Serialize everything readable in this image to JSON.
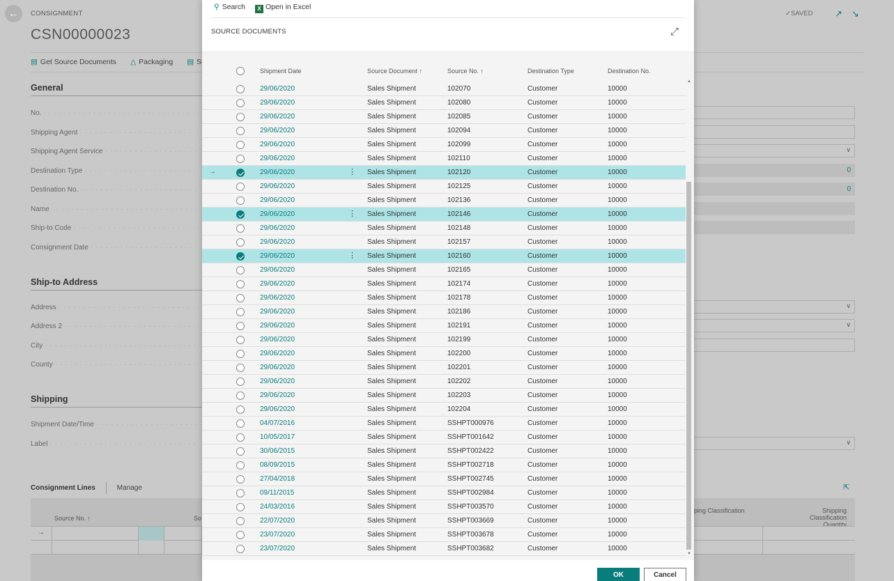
{
  "background": {
    "caption": "CONSIGNMENT",
    "doc_no": "CSN00000023",
    "saved": "SAVED",
    "actions": [
      "Get Source Documents",
      "Packaging",
      "Su"
    ],
    "general": {
      "title": "General",
      "fields": [
        "No.",
        "Shipping Agent",
        "Shipping Agent Service",
        "Destination Type",
        "Destination No.",
        "Name",
        "Ship-to Code",
        "Consignment Date"
      ],
      "right_values": {
        "destination_type": "0",
        "destination_no": "0"
      }
    },
    "ship_to": {
      "title": "Ship-to Address",
      "fields": [
        "Address",
        "Address 2",
        "City",
        "County"
      ]
    },
    "shipping": {
      "title": "Shipping",
      "fields": [
        "Shipment Date/Time",
        "Label"
      ]
    },
    "lines": {
      "tab": "Consignment Lines",
      "manage": "Manage",
      "col_source_no": "Source No. ↑",
      "col_so": "So",
      "col_ship_class": "ping Classification",
      "col_ship_class_qty_1": "Shipping Classification",
      "col_ship_class_qty_2": "Quantity"
    }
  },
  "modal": {
    "toolbar": {
      "search": "Search",
      "excel": "Open in Excel"
    },
    "title": "SOURCE DOCUMENTS",
    "columns": {
      "shipment_date": "Shipment Date",
      "source_document": "Source Document ↑",
      "source_no": "Source No. ↑",
      "destination_type": "Destination Type",
      "destination_no": "Destination No."
    },
    "rows": [
      {
        "date": "29/06/2020",
        "doc": "Sales Shipment",
        "no": "102070",
        "dtype": "Customer",
        "dno": "10000",
        "sel": false
      },
      {
        "date": "29/06/2020",
        "doc": "Sales Shipment",
        "no": "102080",
        "dtype": "Customer",
        "dno": "10000",
        "sel": false
      },
      {
        "date": "29/06/2020",
        "doc": "Sales Shipment",
        "no": "102085",
        "dtype": "Customer",
        "dno": "10000",
        "sel": false
      },
      {
        "date": "29/06/2020",
        "doc": "Sales Shipment",
        "no": "102094",
        "dtype": "Customer",
        "dno": "10000",
        "sel": false
      },
      {
        "date": "29/06/2020",
        "doc": "Sales Shipment",
        "no": "102099",
        "dtype": "Customer",
        "dno": "10000",
        "sel": false
      },
      {
        "date": "29/06/2020",
        "doc": "Sales Shipment",
        "no": "102110",
        "dtype": "Customer",
        "dno": "10000",
        "sel": false
      },
      {
        "date": "29/06/2020",
        "doc": "Sales Shipment",
        "no": "102120",
        "dtype": "Customer",
        "dno": "10000",
        "sel": true,
        "current": true
      },
      {
        "date": "29/06/2020",
        "doc": "Sales Shipment",
        "no": "102125",
        "dtype": "Customer",
        "dno": "10000",
        "sel": false
      },
      {
        "date": "29/06/2020",
        "doc": "Sales Shipment",
        "no": "102136",
        "dtype": "Customer",
        "dno": "10000",
        "sel": false
      },
      {
        "date": "29/06/2020",
        "doc": "Sales Shipment",
        "no": "102146",
        "dtype": "Customer",
        "dno": "10000",
        "sel": true
      },
      {
        "date": "29/06/2020",
        "doc": "Sales Shipment",
        "no": "102148",
        "dtype": "Customer",
        "dno": "10000",
        "sel": false
      },
      {
        "date": "29/06/2020",
        "doc": "Sales Shipment",
        "no": "102157",
        "dtype": "Customer",
        "dno": "10000",
        "sel": false
      },
      {
        "date": "29/06/2020",
        "doc": "Sales Shipment",
        "no": "102160",
        "dtype": "Customer",
        "dno": "10000",
        "sel": true
      },
      {
        "date": "29/06/2020",
        "doc": "Sales Shipment",
        "no": "102165",
        "dtype": "Customer",
        "dno": "10000",
        "sel": false
      },
      {
        "date": "29/06/2020",
        "doc": "Sales Shipment",
        "no": "102174",
        "dtype": "Customer",
        "dno": "10000",
        "sel": false
      },
      {
        "date": "29/06/2020",
        "doc": "Sales Shipment",
        "no": "102178",
        "dtype": "Customer",
        "dno": "10000",
        "sel": false
      },
      {
        "date": "29/06/2020",
        "doc": "Sales Shipment",
        "no": "102186",
        "dtype": "Customer",
        "dno": "10000",
        "sel": false
      },
      {
        "date": "29/06/2020",
        "doc": "Sales Shipment",
        "no": "102191",
        "dtype": "Customer",
        "dno": "10000",
        "sel": false
      },
      {
        "date": "29/06/2020",
        "doc": "Sales Shipment",
        "no": "102199",
        "dtype": "Customer",
        "dno": "10000",
        "sel": false
      },
      {
        "date": "29/06/2020",
        "doc": "Sales Shipment",
        "no": "102200",
        "dtype": "Customer",
        "dno": "10000",
        "sel": false
      },
      {
        "date": "29/06/2020",
        "doc": "Sales Shipment",
        "no": "102201",
        "dtype": "Customer",
        "dno": "10000",
        "sel": false
      },
      {
        "date": "29/06/2020",
        "doc": "Sales Shipment",
        "no": "102202",
        "dtype": "Customer",
        "dno": "10000",
        "sel": false
      },
      {
        "date": "29/06/2020",
        "doc": "Sales Shipment",
        "no": "102203",
        "dtype": "Customer",
        "dno": "10000",
        "sel": false
      },
      {
        "date": "29/06/2020",
        "doc": "Sales Shipment",
        "no": "102204",
        "dtype": "Customer",
        "dno": "10000",
        "sel": false
      },
      {
        "date": "04/07/2016",
        "doc": "Sales Shipment",
        "no": "SSHPT000976",
        "dtype": "Customer",
        "dno": "10000",
        "sel": false
      },
      {
        "date": "10/05/2017",
        "doc": "Sales Shipment",
        "no": "SSHPT001642",
        "dtype": "Customer",
        "dno": "10000",
        "sel": false
      },
      {
        "date": "30/06/2015",
        "doc": "Sales Shipment",
        "no": "SSHPT002422",
        "dtype": "Customer",
        "dno": "10000",
        "sel": false
      },
      {
        "date": "08/09/2015",
        "doc": "Sales Shipment",
        "no": "SSHPT002718",
        "dtype": "Customer",
        "dno": "10000",
        "sel": false
      },
      {
        "date": "27/04/2018",
        "doc": "Sales Shipment",
        "no": "SSHPT002745",
        "dtype": "Customer",
        "dno": "10000",
        "sel": false
      },
      {
        "date": "09/11/2015",
        "doc": "Sales Shipment",
        "no": "SSHPT002984",
        "dtype": "Customer",
        "dno": "10000",
        "sel": false
      },
      {
        "date": "24/03/2016",
        "doc": "Sales Shipment",
        "no": "SSHPT003570",
        "dtype": "Customer",
        "dno": "10000",
        "sel": false
      },
      {
        "date": "22/07/2020",
        "doc": "Sales Shipment",
        "no": "SSHPT003669",
        "dtype": "Customer",
        "dno": "10000",
        "sel": false
      },
      {
        "date": "23/07/2020",
        "doc": "Sales Shipment",
        "no": "SSHPT003678",
        "dtype": "Customer",
        "dno": "10000",
        "sel": false
      },
      {
        "date": "23/07/2020",
        "doc": "Sales Shipment",
        "no": "SSHPT003682",
        "dtype": "Customer",
        "dno": "10000",
        "sel": false
      }
    ],
    "ok": "OK",
    "cancel": "Cancel"
  },
  "colors": {
    "accent": "#0b7c7c",
    "selected_row": "#aee4e6"
  }
}
